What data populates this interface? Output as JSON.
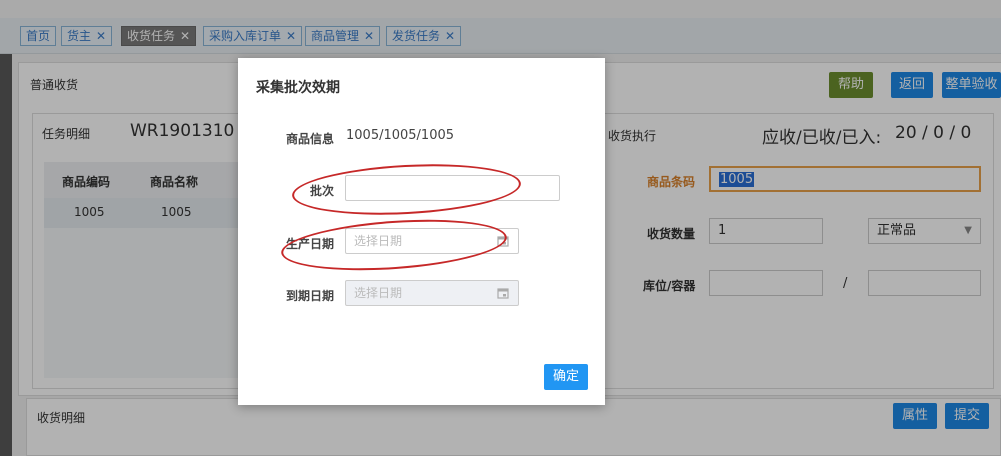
{
  "tabs": [
    {
      "label": "首页",
      "closable": false,
      "active": false
    },
    {
      "label": "货主",
      "closable": true,
      "active": false
    },
    {
      "label": "收货任务",
      "closable": true,
      "active": true
    },
    {
      "label": "采购入库订单",
      "closable": true,
      "active": false
    },
    {
      "label": "商品管理",
      "closable": true,
      "active": false
    },
    {
      "label": "发货任务",
      "closable": true,
      "active": false
    }
  ],
  "close_glyph": "✕",
  "panel": {
    "title": "普通收货",
    "help_label": "帮助",
    "back_label": "返回",
    "whole_check_label": "整单验收"
  },
  "task_detail": {
    "label": "任务明细",
    "task_no": "WR1901310",
    "columns": [
      "商品编码",
      "商品名称"
    ],
    "rows": [
      [
        "1005",
        "1005"
      ]
    ]
  },
  "receive_exec": {
    "label": "收货执行",
    "counts_label": "应收/已收/已入:",
    "counts": "20 / 0 / 0",
    "barcode_label": "商品条码",
    "barcode_value": "1005",
    "qty_label": "收货数量",
    "qty_value": "1",
    "quality_value": "正常品",
    "location_label": "库位/容器",
    "slash": "/"
  },
  "receive_detail": {
    "label": "收货明细",
    "attr_label": "属性",
    "submit_label": "提交"
  },
  "modal": {
    "title": "采集批次效期",
    "product_info_label": "商品信息",
    "product_info_value": "1005/1005/1005",
    "batch_label": "批次",
    "batch_value": "",
    "prod_date_label": "生产日期",
    "prod_date_placeholder": "选择日期",
    "expiry_label": "到期日期",
    "expiry_placeholder": "选择日期",
    "confirm_label": "确定"
  },
  "colors": {
    "annotation_ring": "#c62828",
    "primary": "#1e88e5",
    "olive": "#6c8e2e",
    "barcode_label": "#d9822b"
  }
}
